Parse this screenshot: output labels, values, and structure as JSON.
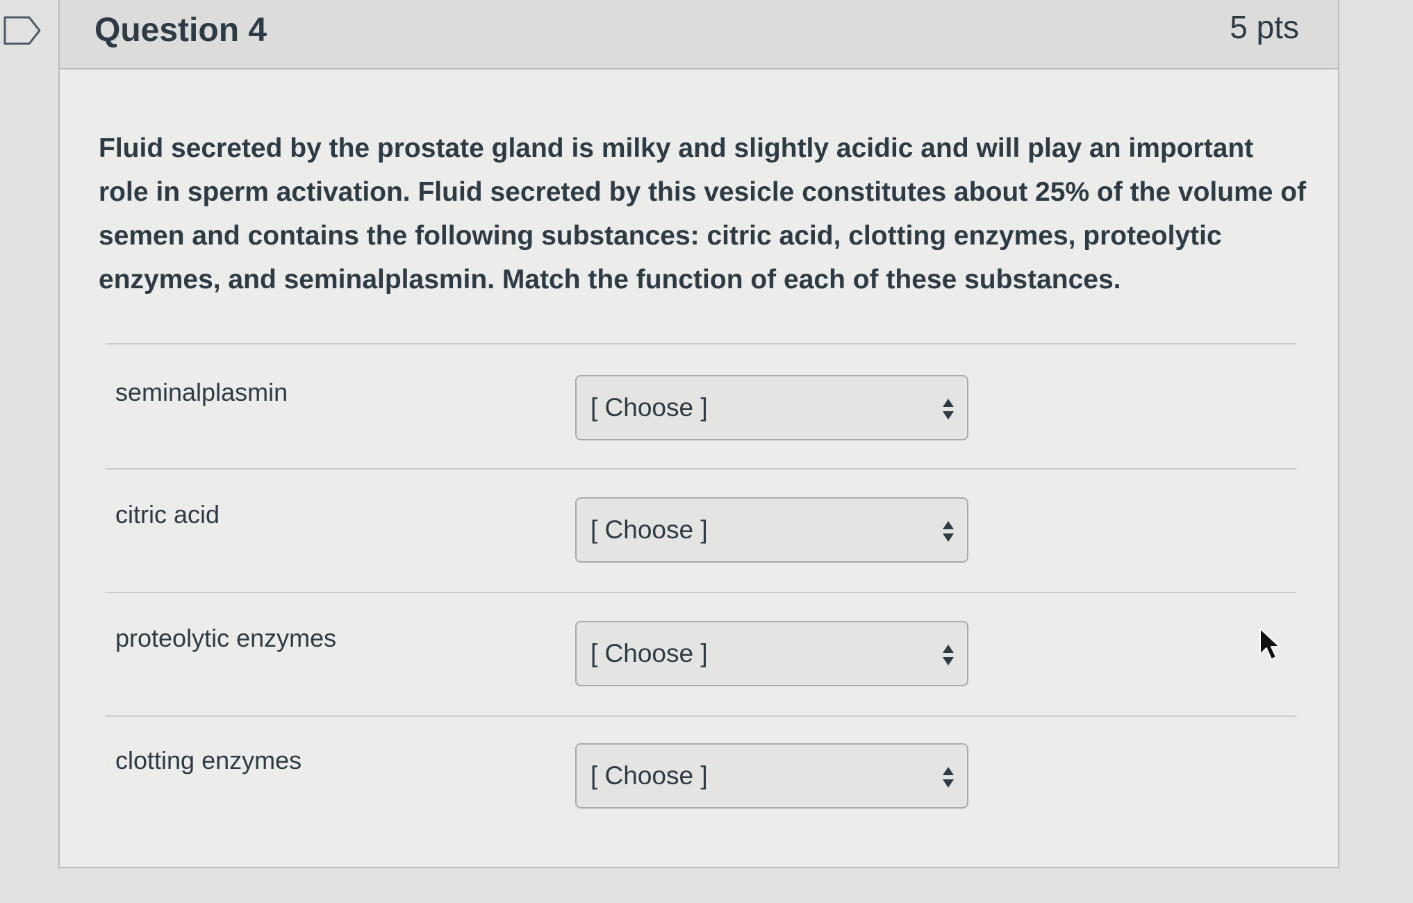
{
  "question": {
    "title": "Question 4",
    "points": "5 pts",
    "text": "Fluid secreted by the prostate gland is milky and slightly acidic and will play an important role in sperm activation. Fluid secreted by this vesicle constitutes about 25% of the volume of semen and contains the following substances: citric acid, clotting enzymes, proteolytic enzymes, and seminalplasmin. Match the function of each of these substances."
  },
  "matches": [
    {
      "label": "seminalplasmin",
      "selected": "[ Choose ]"
    },
    {
      "label": "citric acid",
      "selected": "[ Choose ]"
    },
    {
      "label": "proteolytic enzymes",
      "selected": "[ Choose ]"
    },
    {
      "label": "clotting enzymes",
      "selected": "[ Choose ]"
    }
  ],
  "icons": {
    "flag": "flag-icon",
    "select_arrows": "up-down-arrows-icon",
    "cursor": "mouse-pointer-icon"
  },
  "colors": {
    "text": "#2d3b45",
    "card_background": "#ececea",
    "header_background": "#dcdcdb",
    "border": "#b9bbbd"
  }
}
